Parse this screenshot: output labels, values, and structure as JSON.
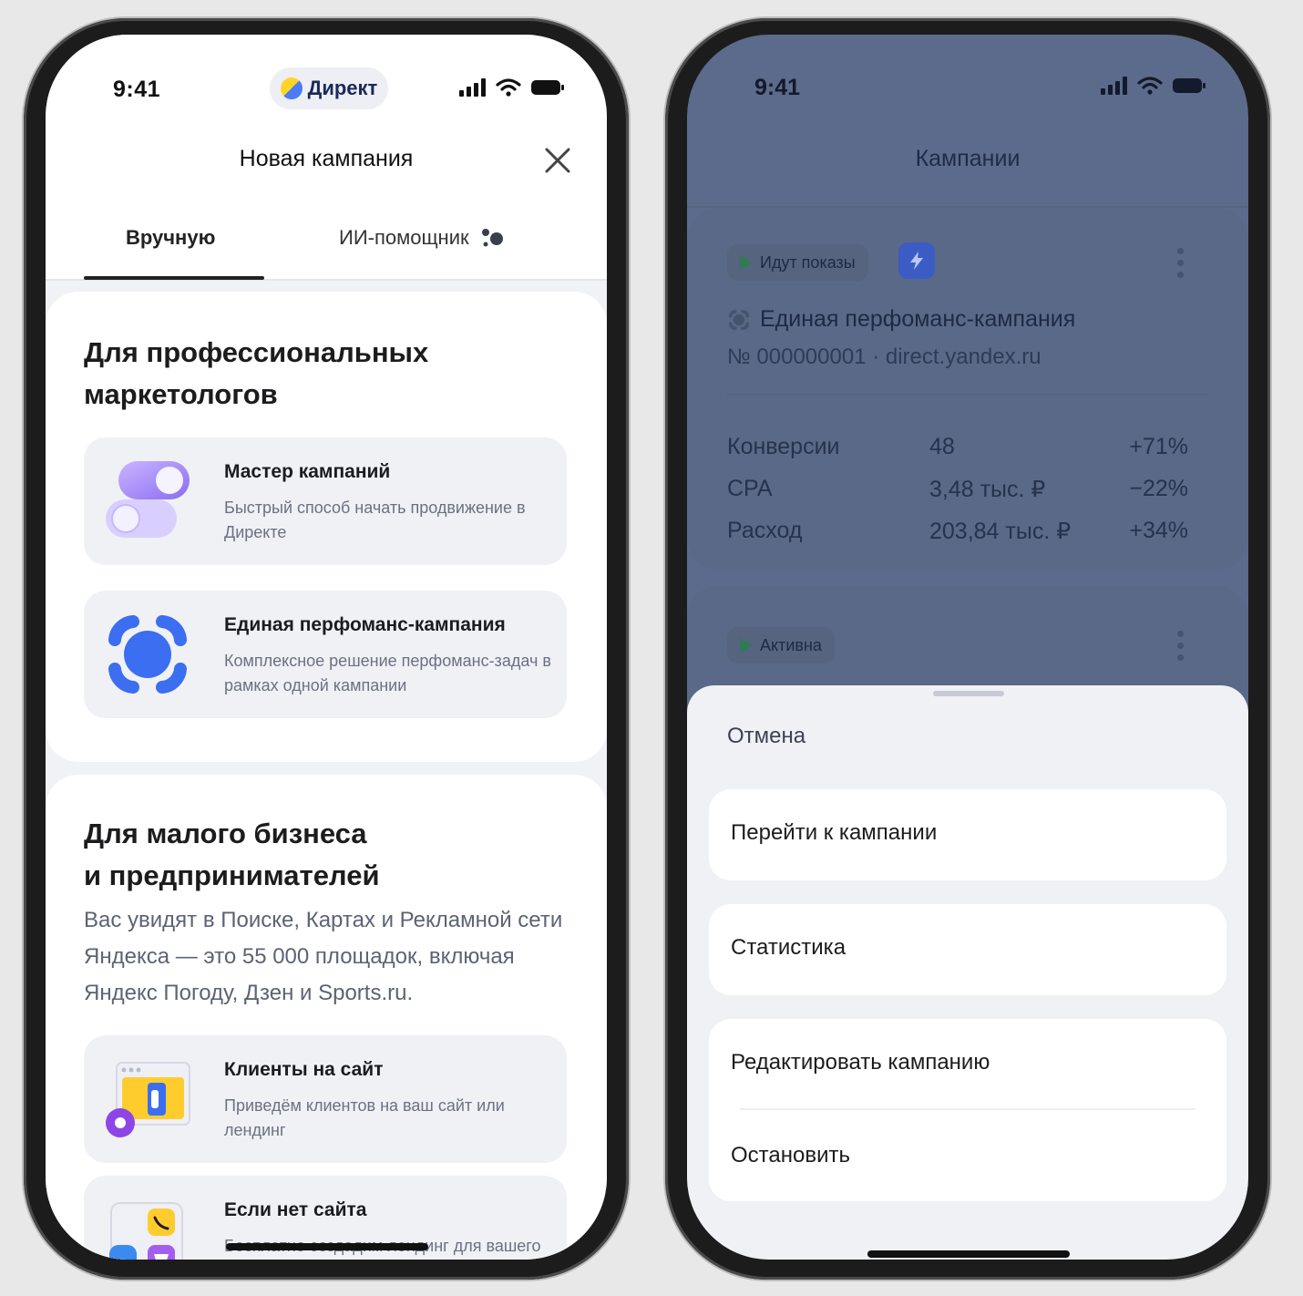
{
  "left": {
    "status": {
      "time": "9:41",
      "app_pill": "Директ"
    },
    "header": {
      "title": "Новая кампания"
    },
    "tabs": [
      {
        "label": "Вручную"
      },
      {
        "label": "ИИ-помощник"
      }
    ],
    "pro_section": {
      "title_line1": "Для профессиональных",
      "title_line2": "маркетологов",
      "options": [
        {
          "title": "Мастер кампаний",
          "subtitle": "Быстрый способ начать продвижение в Директе"
        },
        {
          "title": "Единая перфоманс-кампания",
          "subtitle": "Комплексное решение перфоманс-задач в рамках одной кампании"
        }
      ]
    },
    "small_section": {
      "title_line1": "Для малого бизнеса",
      "title_line2": "и предпринимателей",
      "description": "Вас увидят в Поиске, Картах и Рекламной сети Яндекса — это 55 000 площадок, включая Яндекс Погоду, Дзен и Sports.ru.",
      "options": [
        {
          "title": "Клиенты на сайт",
          "subtitle": "Приведём клиентов на ваш сайт или лендинг"
        },
        {
          "title": "Если нет сайта",
          "subtitle": "Бесплатно создадим лендинг для вашего бизнеса"
        }
      ]
    }
  },
  "right": {
    "status": {
      "time": "9:41"
    },
    "header": {
      "title": "Кампании"
    },
    "campaign1": {
      "status": "Идут показы",
      "name": "Единая перфоманс-кампания",
      "subtitle": "№ 000000001 · direct.yandex.ru",
      "stats": [
        {
          "label": "Конверсии",
          "value": "48",
          "delta": "+71%"
        },
        {
          "label": "CPA",
          "value": "3,48 тыс. ₽",
          "delta": "−22%"
        },
        {
          "label": "Расход",
          "value": "203,84 тыс. ₽",
          "delta": "+34%"
        }
      ]
    },
    "campaign2": {
      "status": "Активна"
    },
    "sheet": {
      "cancel": "Отмена",
      "go_to": "Перейти к кампании",
      "statistics": "Статистика",
      "edit": "Редактировать кампанию",
      "stop": "Остановить"
    }
  }
}
